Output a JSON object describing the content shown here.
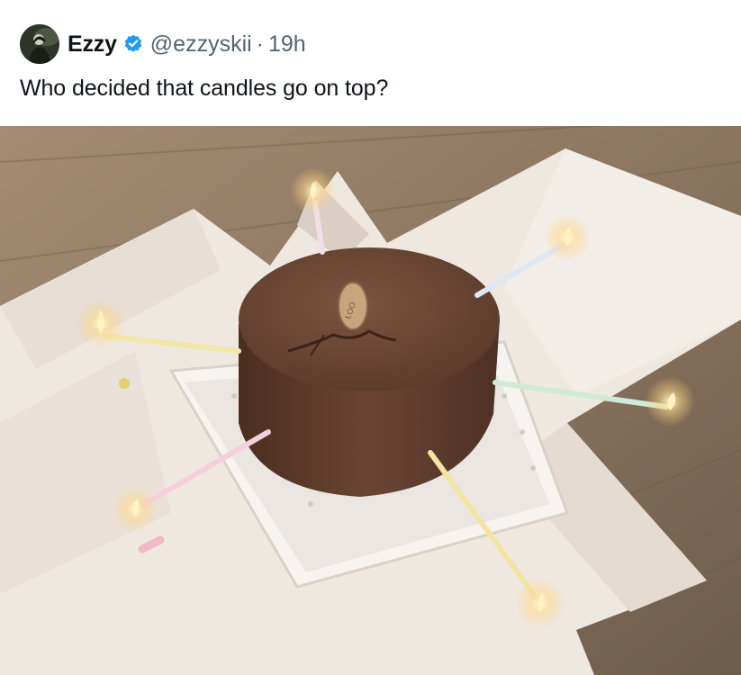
{
  "tweet": {
    "display_name": "Ezzy",
    "handle": "@ezzyskii",
    "separator": "·",
    "timestamp": "19h",
    "text": "Who decided that candles go on top?",
    "icons": {
      "avatar": "avatar-image",
      "verified": "verified-badge-icon"
    },
    "colors": {
      "verified": "#1d9bf0",
      "secondary_text": "#536471",
      "primary_text": "#0f1419"
    },
    "media": {
      "description_icon": "photo-cake-candles-sideways"
    }
  }
}
